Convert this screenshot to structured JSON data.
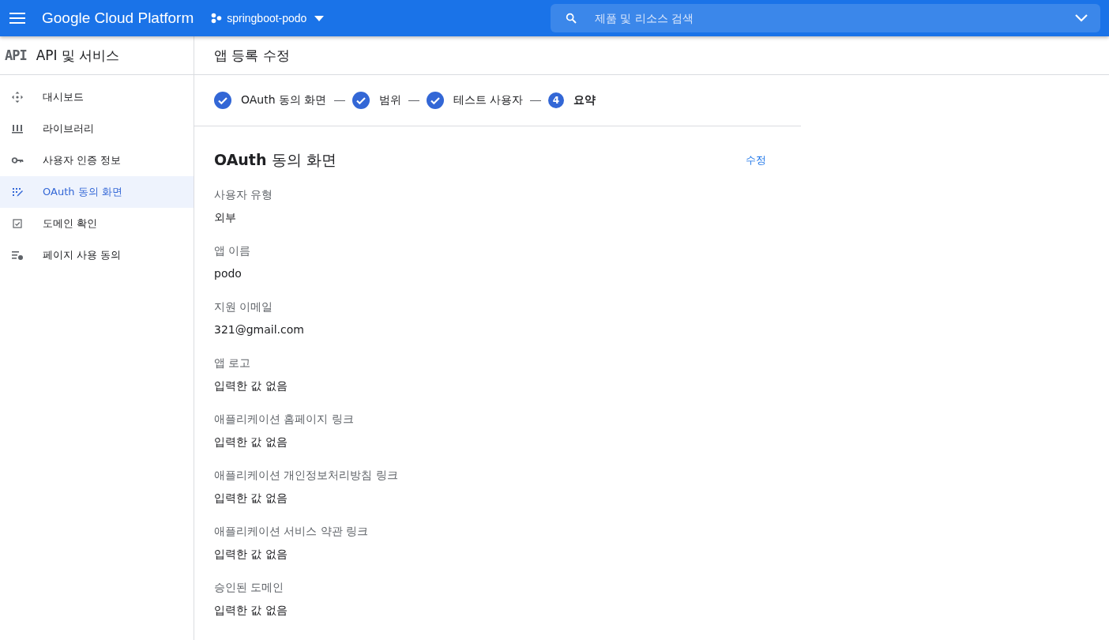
{
  "topbar": {
    "product": "Google Cloud Platform",
    "project": "springboot-podo",
    "search": {
      "placeholder": "제품 및 리소스 검색"
    }
  },
  "sidebar": {
    "logo": "API",
    "title": "API 및 서비스",
    "items": [
      {
        "label": "대시보드",
        "kind": "dashboard",
        "selected": false
      },
      {
        "label": "라이브러리",
        "kind": "library",
        "selected": false
      },
      {
        "label": "사용자 인증 정보",
        "kind": "key",
        "selected": false
      },
      {
        "label": "OAuth 동의 화면",
        "kind": "consent",
        "selected": true
      },
      {
        "label": "도메인 확인",
        "kind": "check",
        "selected": false
      },
      {
        "label": "페이지 사용 동의",
        "kind": "settings",
        "selected": false
      }
    ]
  },
  "page": {
    "title": "앱 등록 수정",
    "steps": [
      {
        "label": "OAuth 동의 화면",
        "completed": true,
        "selected": false
      },
      {
        "label": "범위",
        "completed": true,
        "selected": false
      },
      {
        "label": "테스트 사용자",
        "completed": true,
        "selected": false
      },
      {
        "label": "요약",
        "completed": false,
        "number": "4",
        "selected": true
      }
    ],
    "section": {
      "title": "**OAuth** 동의 화면",
      "edit": "수정",
      "fields": [
        {
          "label": "사용자 유형",
          "value": "외부"
        },
        {
          "label": "앱 이름",
          "value": "podo"
        },
        {
          "label": "지원 이메일",
          "value": "321@gmail.com"
        },
        {
          "label": "앱 로고",
          "value": "입력한 값 없음"
        },
        {
          "label": "애플리케이션 홈페이지 링크",
          "value": "입력한 값 없음"
        },
        {
          "label": "애플리케이션 개인정보처리방침 링크",
          "value": "입력한 값 없음"
        },
        {
          "label": "애플리케이션 서비스 약관 링크",
          "value": "입력한 값 없음"
        },
        {
          "label": "승인된 도메인",
          "value": "입력한 값 없음"
        }
      ]
    }
  }
}
